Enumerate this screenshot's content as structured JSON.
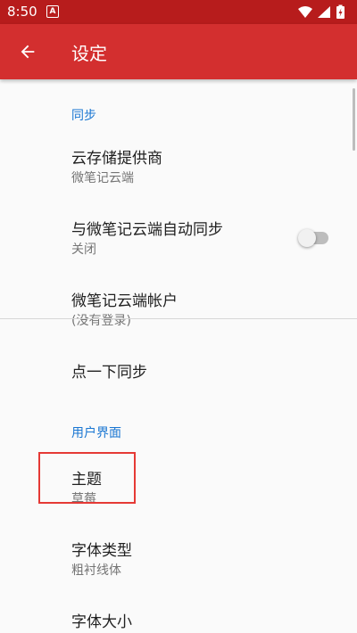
{
  "status_bar": {
    "time": "8:50",
    "notification_glyph": "A",
    "icons": [
      "wifi-icon",
      "signal-icon",
      "battery-charging-icon"
    ]
  },
  "app_bar": {
    "title": "设定",
    "back_icon": "arrow-back-icon"
  },
  "colors": {
    "status_bar": "#b71c1c",
    "app_bar": "#d32f2f",
    "section_header": "#1976d2",
    "highlight_box": "#e53935"
  },
  "sections": [
    {
      "header": "同步",
      "items": [
        {
          "title": "云存储提供商",
          "summary": "微笔记云端"
        },
        {
          "title": "与微笔记云端自动同步",
          "summary": "关闭",
          "toggle": false
        },
        {
          "title": "微笔记云端帐户",
          "summary": "(没有登录)"
        },
        {
          "title": "点一下同步",
          "summary": ""
        }
      ]
    },
    {
      "header": "用户界面",
      "items": [
        {
          "title": "主题",
          "summary": "草莓"
        },
        {
          "title": "字体类型",
          "summary": "粗衬线体"
        },
        {
          "title": "字体大小",
          "summary": ""
        }
      ]
    }
  ]
}
